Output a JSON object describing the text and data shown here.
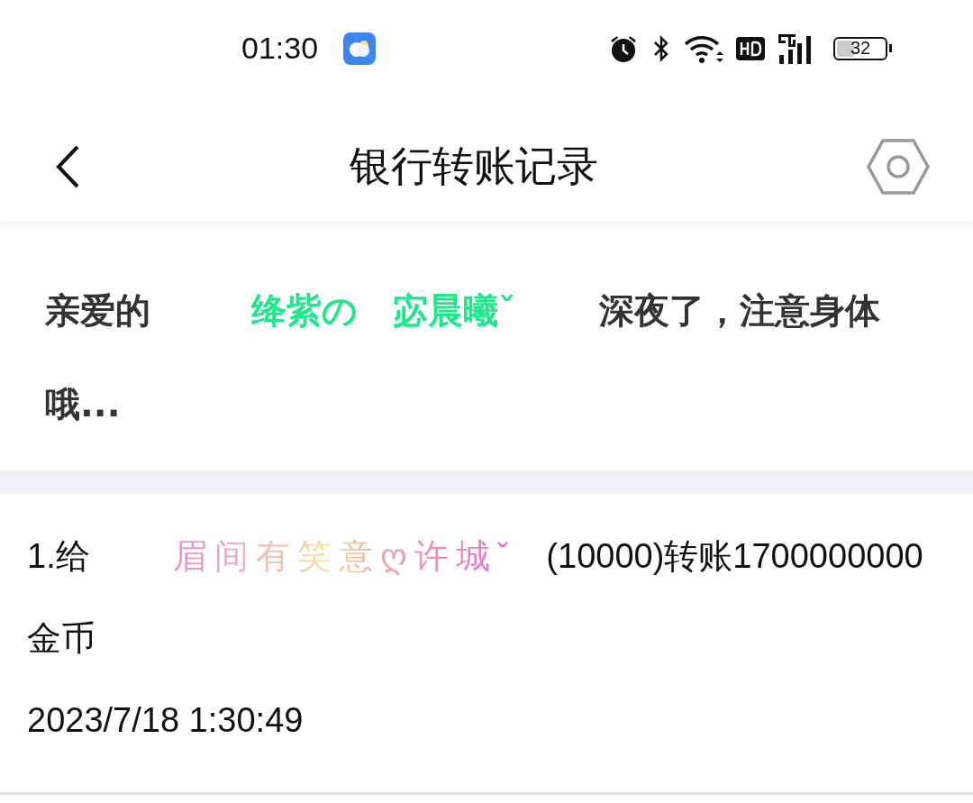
{
  "status_bar": {
    "time": "01:30",
    "battery": "32"
  },
  "header": {
    "title": "银行转账记录"
  },
  "greeting": {
    "prefix": "亲爱的",
    "name": "绛紫の　宓晨曦ˇ",
    "suffix": "深夜了，注意身体哦..."
  },
  "records": [
    {
      "prefix": "1.给",
      "name": "眉间有笑意ღ许城ˇ",
      "text": "(10000)转账1700000000金币",
      "time": "2023/7/18 1:30:49"
    }
  ]
}
